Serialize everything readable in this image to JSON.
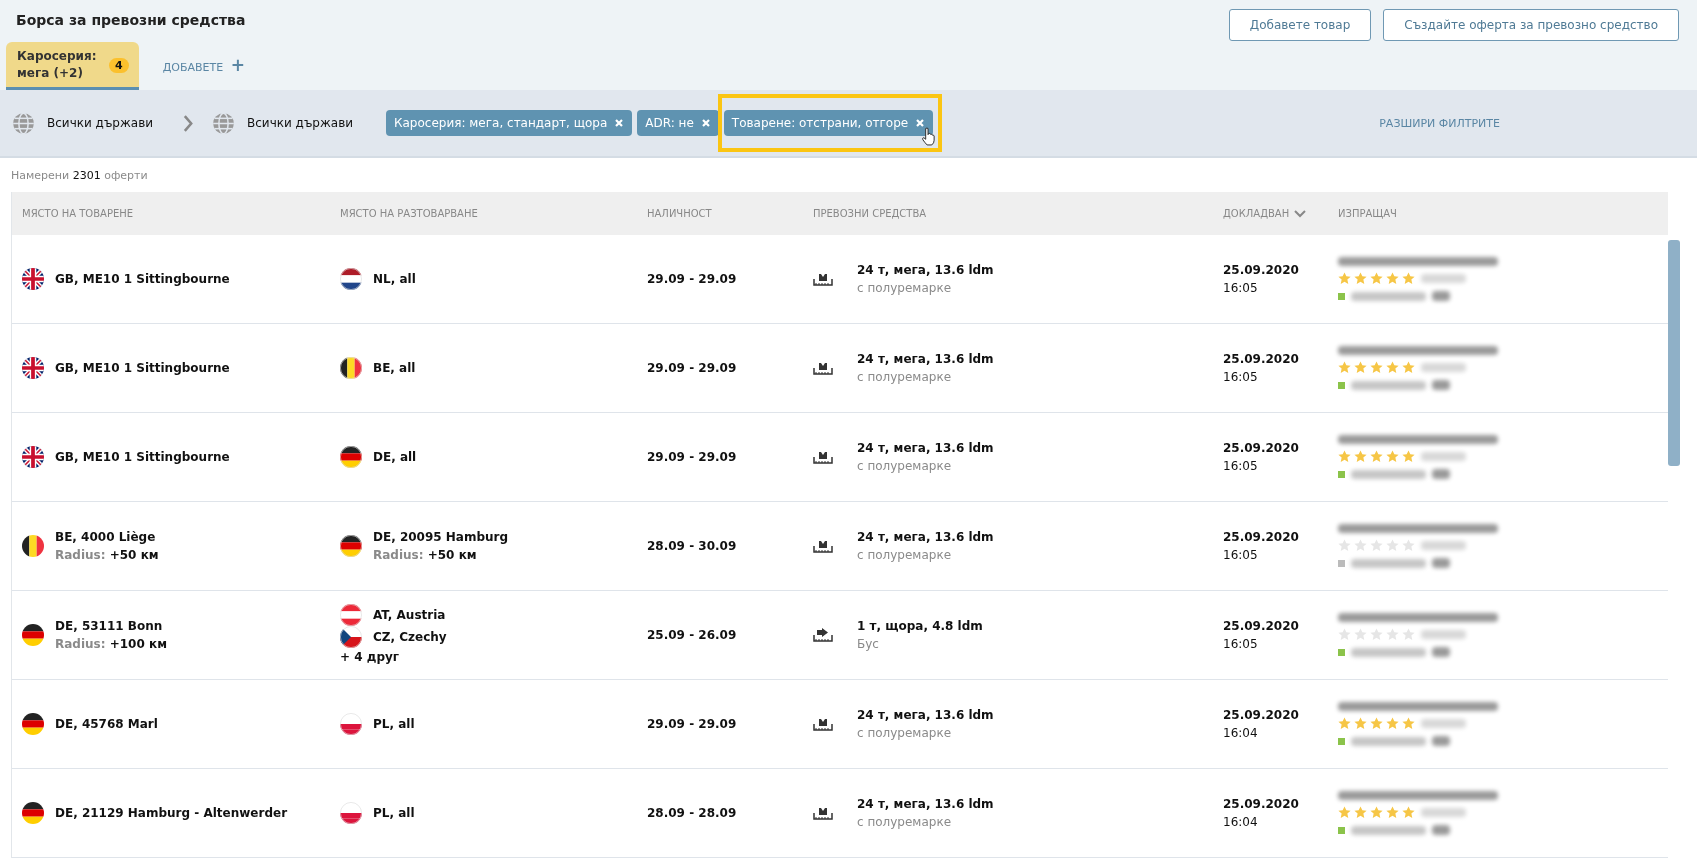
{
  "title": "Борса за превозни средства",
  "actions": [
    "Добавете товар",
    "Създайте оферта за превозно средство"
  ],
  "tabs": [
    {
      "label": "Каросерия: мега (+2)",
      "badge": "4",
      "selected": true
    }
  ],
  "add_tab": {
    "label": "ДОБАВЕТЕ",
    "icon": "+"
  },
  "route": {
    "from": "Всички държави",
    "to": "Всички държави"
  },
  "chips": [
    {
      "label": "Каросерия: мега, стандарт, щора",
      "highlighted": false
    },
    {
      "label": "ADR: не",
      "highlighted": false
    },
    {
      "label": "Товарене: отстрани, отгоре",
      "highlighted": true
    }
  ],
  "expand_filters": "РАЗШИРИ ФИЛТРИТЕ",
  "results": {
    "prefix": "Намерени",
    "count": "2301",
    "suffix": "оферти"
  },
  "columns": [
    {
      "label": "МЯСТО НА ТОВАРЕНЕ",
      "sorted": false
    },
    {
      "label": "МЯСТО НА РАЗТОВАРВАНЕ",
      "sorted": false
    },
    {
      "label": "НАЛИЧНОСТ",
      "sorted": false
    },
    {
      "label": "ПРЕВОЗНИ СРЕДСТВА",
      "sorted": false
    },
    {
      "label": "ДОКЛАДВАН",
      "sorted": true
    },
    {
      "label": "ИЗПРАЩАЧ",
      "sorted": false
    }
  ],
  "rows": [
    {
      "load": {
        "kind": "gb",
        "place": "GB, ME10 1 Sittingbourne"
      },
      "unload": [
        {
          "kind": "nl",
          "place": "NL, all"
        }
      ],
      "dates": "29.09 - 29.09",
      "vehicle": {
        "kind": "mega",
        "main": "24 т, мега, 13.6 ldm",
        "sub": "с полуремарке"
      },
      "date": "25.09.2020",
      "time": "16:05",
      "sender": {
        "stars": 5,
        "color": "#8bc34a"
      }
    },
    {
      "load": {
        "kind": "gb",
        "place": "GB, ME10 1 Sittingbourne"
      },
      "unload": [
        {
          "kind": "be",
          "place": "BE, all"
        }
      ],
      "dates": "29.09 - 29.09",
      "vehicle": {
        "kind": "mega",
        "main": "24 т, мега, 13.6 ldm",
        "sub": "с полуремарке"
      },
      "date": "25.09.2020",
      "time": "16:05",
      "sender": {
        "stars": 5,
        "color": "#8bc34a"
      }
    },
    {
      "load": {
        "kind": "gb",
        "place": "GB, ME10 1 Sittingbourne"
      },
      "unload": [
        {
          "kind": "de",
          "place": "DE, all"
        }
      ],
      "dates": "29.09 - 29.09",
      "vehicle": {
        "kind": "mega",
        "main": "24 т, мега, 13.6 ldm",
        "sub": "с полуремарке"
      },
      "date": "25.09.2020",
      "time": "16:05",
      "sender": {
        "stars": 5,
        "color": "#8bc34a"
      }
    },
    {
      "load": {
        "kind": "be",
        "place": "BE, 4000 Liège",
        "radius_label": "Radius:",
        "radius": "+50 км"
      },
      "unload": [
        {
          "kind": "de",
          "place": "DE, 20095 Hamburg",
          "radius_label": "Radius:",
          "radius": "+50 км"
        }
      ],
      "dates": "28.09 - 30.09",
      "vehicle": {
        "kind": "mega",
        "main": "24 т, мега, 13.6 ldm",
        "sub": "с полуремарке"
      },
      "date": "25.09.2020",
      "time": "16:05",
      "sender": {
        "stars": 0,
        "color": "#bbbbbb"
      }
    },
    {
      "load": {
        "kind": "de",
        "place": "DE, 53111 Bonn",
        "radius_label": "Radius:",
        "radius": "+100 км"
      },
      "unload": [
        {
          "kind": "at",
          "place": "AT, Austria"
        },
        {
          "kind": "cz",
          "place": "CZ, Czechy"
        }
      ],
      "unload_more": "+ 4 друг",
      "dates": "25.09 - 26.09",
      "vehicle": {
        "kind": "bus",
        "main": "1 т, щора, 4.8 ldm",
        "sub": "Бус"
      },
      "date": "25.09.2020",
      "time": "16:05",
      "sender": {
        "stars": 0,
        "color": "#8bc34a"
      }
    },
    {
      "load": {
        "kind": "de",
        "place": "DE, 45768 Marl"
      },
      "unload": [
        {
          "kind": "pl",
          "place": "PL, all"
        }
      ],
      "dates": "29.09 - 29.09",
      "vehicle": {
        "kind": "mega",
        "main": "24 т, мега, 13.6 ldm",
        "sub": "с полуремарке"
      },
      "date": "25.09.2020",
      "time": "16:04",
      "sender": {
        "stars": 5,
        "color": "#8bc34a"
      }
    },
    {
      "load": {
        "kind": "de",
        "place": "DE, 21129 Hamburg - Altenwerder"
      },
      "unload": [
        {
          "kind": "pl",
          "place": "PL, all"
        }
      ],
      "dates": "28.09 - 28.09",
      "vehicle": {
        "kind": "mega",
        "main": "24 т, мега, 13.6 ldm",
        "sub": "с полуремарке"
      },
      "date": "25.09.2020",
      "time": "16:04",
      "sender": {
        "stars": 5,
        "color": "#8bc34a"
      }
    }
  ]
}
